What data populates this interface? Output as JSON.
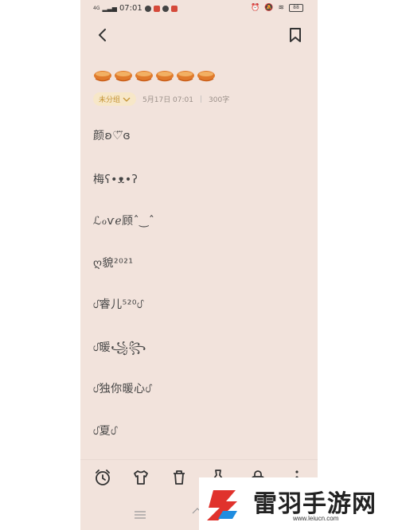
{
  "status_bar": {
    "network": "4G",
    "time": "07:01",
    "battery": "88"
  },
  "note": {
    "category": "未分组",
    "date": "5月17日 07:01",
    "separator": "|",
    "word_count": "300字",
    "lines": [
      "颜ʚ♡⃛ɞ",
      "梅ʕ•ᴥ•ʔ",
      "ℒℴѵℯ顾ˆ‿ˆ",
      "ღ貌²⁰²¹",
      "ᦔ睿儿⁵²⁰ᦔ",
      "ᦔ暖꧁꧂",
      "ᦔ独你暖心ᦔ",
      "ᦔ夏ᦔ"
    ]
  },
  "watermark": {
    "text": "雷羽手游网",
    "url": "www.leiucn.com"
  },
  "colors": {
    "background": "#f2e3dc",
    "accent": "#c59434",
    "bowl": "#e07a2c"
  }
}
